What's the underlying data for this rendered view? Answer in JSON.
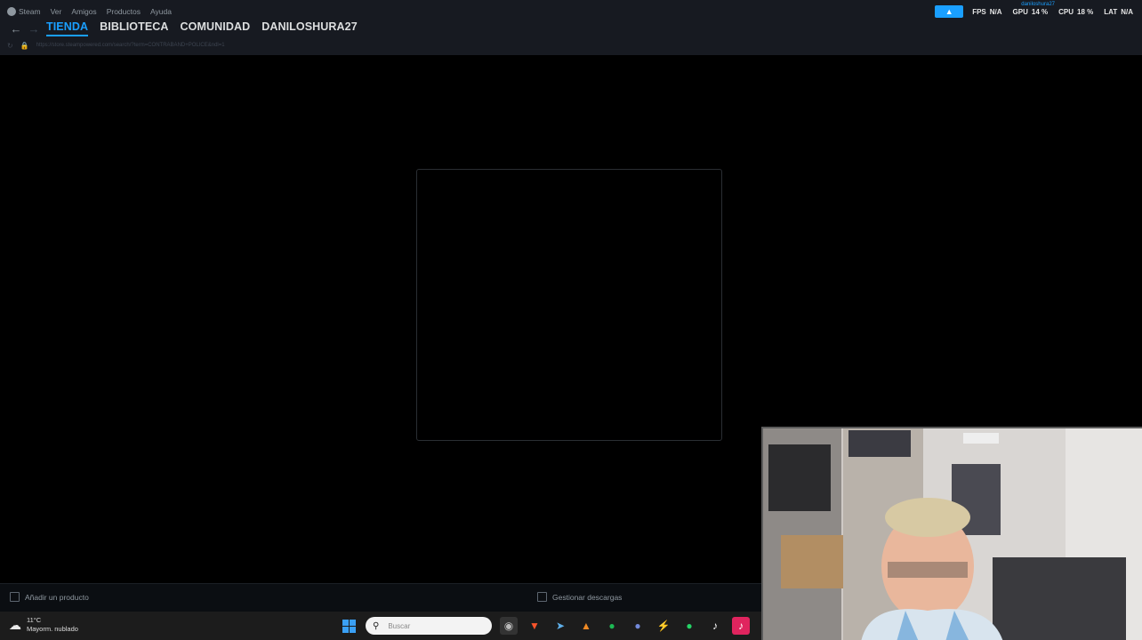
{
  "menubar": {
    "items": [
      "Steam",
      "Ver",
      "Amigos",
      "Productos",
      "Ayuda"
    ]
  },
  "nav": {
    "tabs": [
      "TIENDA",
      "BIBLIOTECA",
      "COMUNIDAD",
      "DANILOSHURA27"
    ],
    "active_tab": "TIENDA",
    "url": "https://store.steampowered.com/search/?term=CONTRABAND+POLICE&ndl=1"
  },
  "overlay": {
    "username": "daniloshura27",
    "fps_label": "FPS",
    "fps_value": "N/A",
    "gpu_label": "GPU",
    "gpu_value": "14 %",
    "cpu_label": "CPU",
    "cpu_value": "18 %",
    "lat_label": "LAT",
    "lat_value": "N/A"
  },
  "bottom": {
    "add_product": "Añadir un producto",
    "manage_downloads": "Gestionar descargas"
  },
  "taskbar": {
    "temperature": "11°C",
    "weather": "Mayorm. nublado",
    "search_placeholder": "Buscar",
    "apps": [
      "windows-start",
      "search",
      "chrome",
      "brave",
      "telegram",
      "antivirus",
      "spotify",
      "discord",
      "winamp",
      "whatsapp",
      "tiktok",
      "tiktok-studio"
    ]
  },
  "colors": {
    "accent": "#1a9fff",
    "steam_bar": "#171a21",
    "background": "#000000"
  }
}
